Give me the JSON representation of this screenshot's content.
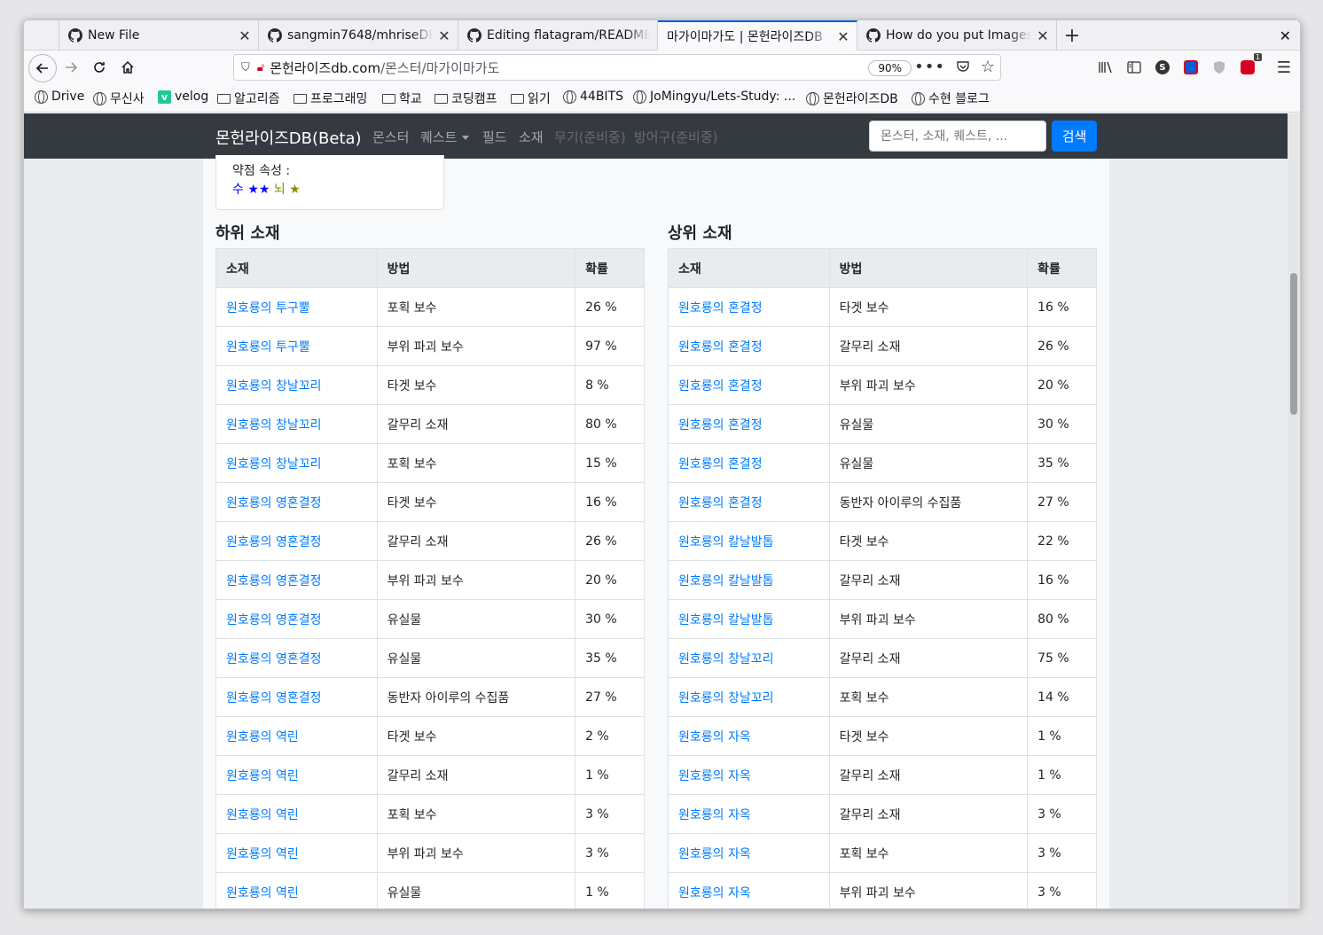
{
  "browser": {
    "tabs": [
      {
        "title": "New File",
        "icon": "github-icon"
      },
      {
        "title": "sangmin7648/mhriseDB",
        "icon": "github-icon"
      },
      {
        "title": "Editing flatagram/README",
        "icon": "github-icon"
      },
      {
        "title": "마가이마가도 | 몬헌라이즈DB",
        "icon": "none",
        "active": true
      },
      {
        "title": "How do you put Images on",
        "icon": "github-icon"
      }
    ],
    "url_host": "몬헌라이즈db.com",
    "url_path": "/몬스터/마가이마가도",
    "zoom": "90%",
    "bookmarks": [
      {
        "label": "Drive",
        "icon": "globe-icon"
      },
      {
        "label": "무신사",
        "icon": "globe-icon"
      },
      {
        "label": "velog",
        "icon": "velog-icon"
      },
      {
        "label": "알고리즘",
        "icon": "folder-icon"
      },
      {
        "label": "프로그래밍",
        "icon": "folder-icon"
      },
      {
        "label": "학교",
        "icon": "folder-icon"
      },
      {
        "label": "코딩캠프",
        "icon": "folder-icon"
      },
      {
        "label": "읽기",
        "icon": "folder-icon"
      },
      {
        "label": "44BITS",
        "icon": "globe-icon"
      },
      {
        "label": "JoMingyu/Lets-Study: ...",
        "icon": "globe-icon"
      },
      {
        "label": "몬헌라이즈DB",
        "icon": "globe-icon"
      },
      {
        "label": "수현 블로그",
        "icon": "globe-icon"
      }
    ],
    "notification_count": "1"
  },
  "site": {
    "brand": "몬헌라이즈DB(Beta)",
    "nav": {
      "monster": "몬스터",
      "quest": "퀘스트",
      "field": "필드",
      "material": "소재",
      "weapon": "무기(준비중)",
      "armor": "방어구(준비중)"
    },
    "search_placeholder": "몬스터, 소재, 퀘스트, ...",
    "search_button": "검색"
  },
  "weakness": {
    "label": "약점 속성 :",
    "water": "수",
    "water_stars": "★★",
    "thunder": "뇌",
    "thunder_stars": "★"
  },
  "tables": {
    "headers": [
      "소재",
      "방법",
      "확률"
    ],
    "lower": {
      "title": "하위 소재",
      "rows": [
        [
          "원호룡의 투구뿔",
          "포획 보수",
          "26 %"
        ],
        [
          "원호룡의 투구뿔",
          "부위 파괴 보수",
          "97 %"
        ],
        [
          "원호룡의 창날꼬리",
          "타겟 보수",
          "8 %"
        ],
        [
          "원호룡의 창날꼬리",
          "갈무리 소재",
          "80 %"
        ],
        [
          "원호룡의 창날꼬리",
          "포획 보수",
          "15 %"
        ],
        [
          "원호룡의 영혼결정",
          "타겟 보수",
          "16 %"
        ],
        [
          "원호룡의 영혼결정",
          "갈무리 소재",
          "26 %"
        ],
        [
          "원호룡의 영혼결정",
          "부위 파괴 보수",
          "20 %"
        ],
        [
          "원호룡의 영혼결정",
          "유실물",
          "30 %"
        ],
        [
          "원호룡의 영혼결정",
          "유실물",
          "35 %"
        ],
        [
          "원호룡의 영혼결정",
          "동반자 아이루의 수집품",
          "27 %"
        ],
        [
          "원호룡의 역린",
          "타겟 보수",
          "2 %"
        ],
        [
          "원호룡의 역린",
          "갈무리 소재",
          "1 %"
        ],
        [
          "원호룡의 역린",
          "포획 보수",
          "3 %"
        ],
        [
          "원호룡의 역린",
          "부위 파괴 보수",
          "3 %"
        ],
        [
          "원호룡의 역린",
          "유실물",
          "1 %"
        ]
      ]
    },
    "upper": {
      "title": "상위 소재",
      "rows": [
        [
          "원호룡의 혼결정",
          "타겟 보수",
          "16 %"
        ],
        [
          "원호룡의 혼결정",
          "갈무리 소재",
          "26 %"
        ],
        [
          "원호룡의 혼결정",
          "부위 파괴 보수",
          "20 %"
        ],
        [
          "원호룡의 혼결정",
          "유실물",
          "30 %"
        ],
        [
          "원호룡의 혼결정",
          "유실물",
          "35 %"
        ],
        [
          "원호룡의 혼결정",
          "동반자 아이루의 수집품",
          "27 %"
        ],
        [
          "원호룡의 칼날발톱",
          "타겟 보수",
          "22 %"
        ],
        [
          "원호룡의 칼날발톱",
          "갈무리 소재",
          "16 %"
        ],
        [
          "원호룡의 칼날발톱",
          "부위 파괴 보수",
          "80 %"
        ],
        [
          "원호룡의 창날꼬리",
          "갈무리 소재",
          "75 %"
        ],
        [
          "원호룡의 창날꼬리",
          "포획 보수",
          "14 %"
        ],
        [
          "원호룡의 자옥",
          "타겟 보수",
          "1 %"
        ],
        [
          "원호룡의 자옥",
          "갈무리 소재",
          "1 %"
        ],
        [
          "원호룡의 자옥",
          "갈무리 소재",
          "3 %"
        ],
        [
          "원호룡의 자옥",
          "포획 보수",
          "3 %"
        ],
        [
          "원호룡의 자옥",
          "부위 파괴 보수",
          "3 %"
        ]
      ]
    }
  },
  "colors": {
    "navbar": "#343a40",
    "link": "#007bff",
    "search_button": "#007bff",
    "water": "#0000ff",
    "thunder": "#8a8a00"
  }
}
